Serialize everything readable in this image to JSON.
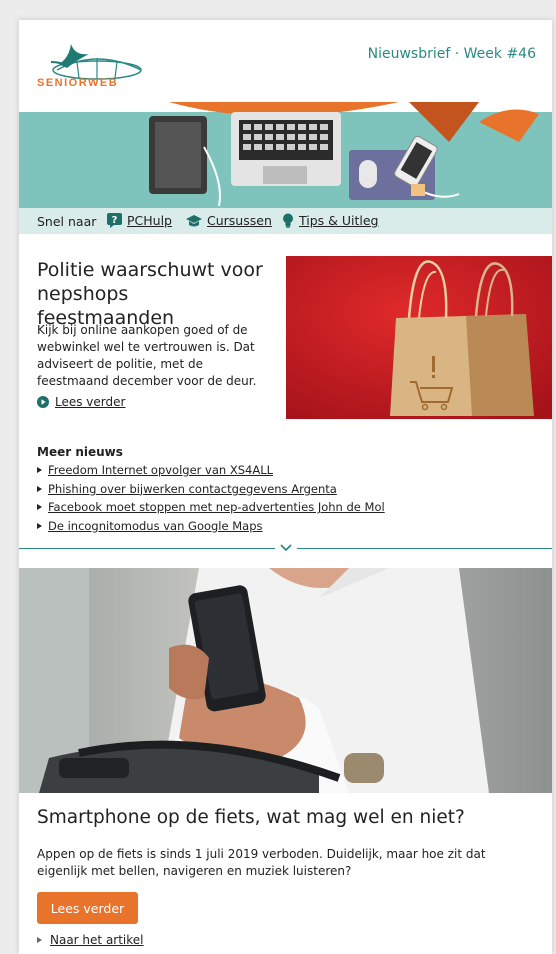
{
  "header": {
    "brand": "SENIORWEB",
    "issue_label": "Nieuwsbrief · Week #46"
  },
  "quicknav": {
    "label": "Snel naar",
    "items": [
      {
        "label": "PCHulp",
        "icon": "question-icon"
      },
      {
        "label": "Cursussen",
        "icon": "graduation-cap-icon"
      },
      {
        "label": "Tips & Uitleg",
        "icon": "lightbulb-icon"
      }
    ]
  },
  "article1": {
    "title": "Politie waarschuwt voor nepshops feestmaanden",
    "body": "Kijk bij online aankopen goed of de webwinkel wel te vertrouwen is. Dat adviseert de politie, met de feestmaand december voor de deur.",
    "read_more": "Lees verder"
  },
  "more_news": {
    "title": "Meer nieuws",
    "items": [
      "Freedom Internet opvolger van XS4ALL",
      "Phishing over bijwerken contactgegevens Argenta",
      "Facebook moet stoppen met nep-advertenties John de Mol",
      "De incognitomodus van Google Maps"
    ]
  },
  "article2": {
    "title": "Smartphone op de fiets, wat mag wel en niet?",
    "body": "Appen op de fiets is sinds 1 juli 2019 verboden. Duidelijk, maar hoe zit dat eigenlijk met bellen, navigeren en muziek luisteren?",
    "button": "Lees verder",
    "link": "Naar het artikel"
  },
  "colors": {
    "accent_teal": "#2a8a83",
    "accent_orange": "#e8742c",
    "nav_bg": "#d9ecea"
  }
}
